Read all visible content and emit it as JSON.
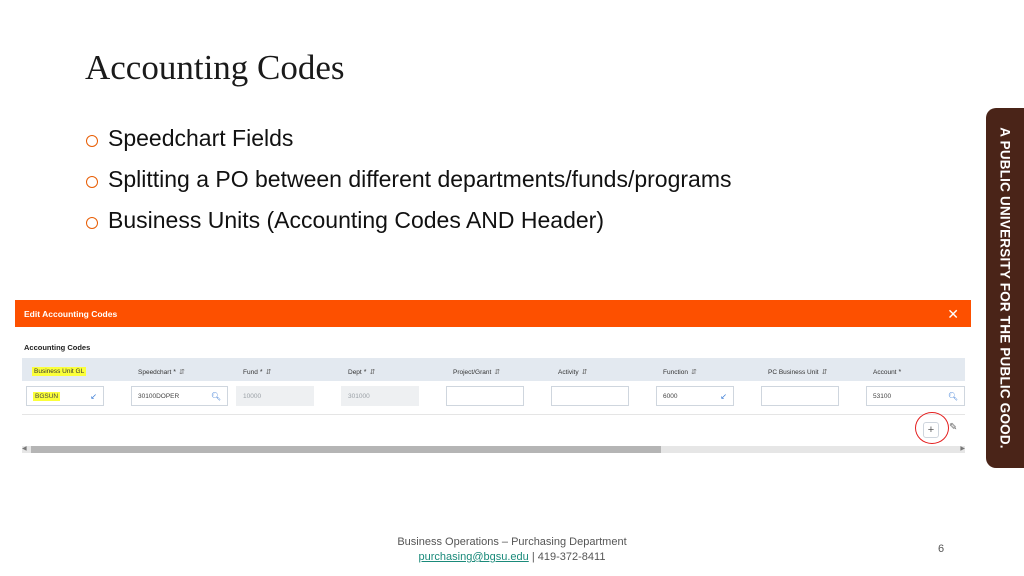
{
  "slide": {
    "title": "Accounting Codes",
    "bullets": [
      "Speedchart Fields",
      "Splitting a PO between different departments/funds/programs",
      "Business Units (Accounting Codes AND Header)"
    ],
    "side_banner": "A PUBLIC UNIVERSITY FOR THE PUBLIC GOOD."
  },
  "modal": {
    "title": "Edit Accounting Codes",
    "close_symbol": "✕",
    "section_label": "Accounting Codes",
    "accent_color": "#fd5000",
    "columns": [
      {
        "label": "Business Unit GL",
        "required": false,
        "sortable": false
      },
      {
        "label": "Speedchart",
        "required": true,
        "sortable": true
      },
      {
        "label": "Fund",
        "required": true,
        "sortable": true
      },
      {
        "label": "Dept",
        "required": true,
        "sortable": true
      },
      {
        "label": "Project/Grant",
        "required": false,
        "sortable": true
      },
      {
        "label": "Activity",
        "required": false,
        "sortable": true
      },
      {
        "label": "Function",
        "required": false,
        "sortable": true
      },
      {
        "label": "PC Business Unit",
        "required": false,
        "sortable": true
      },
      {
        "label": "Account",
        "required": true,
        "sortable": false
      }
    ],
    "row": {
      "business_unit": "BGSUN",
      "speedchart": "30100DOPER",
      "fund": "10000",
      "dept": "301000",
      "project_grant": "",
      "activity": "",
      "function": "6000",
      "pc_business_unit": "",
      "account": "53100"
    },
    "add_row_symbol": "+",
    "required_symbol": "*"
  },
  "footer": {
    "department": "Business Operations – Purchasing Department",
    "email": "purchasing@bgsu.edu",
    "separator": " | ",
    "phone": "419-372-8411",
    "page_number": "6"
  }
}
